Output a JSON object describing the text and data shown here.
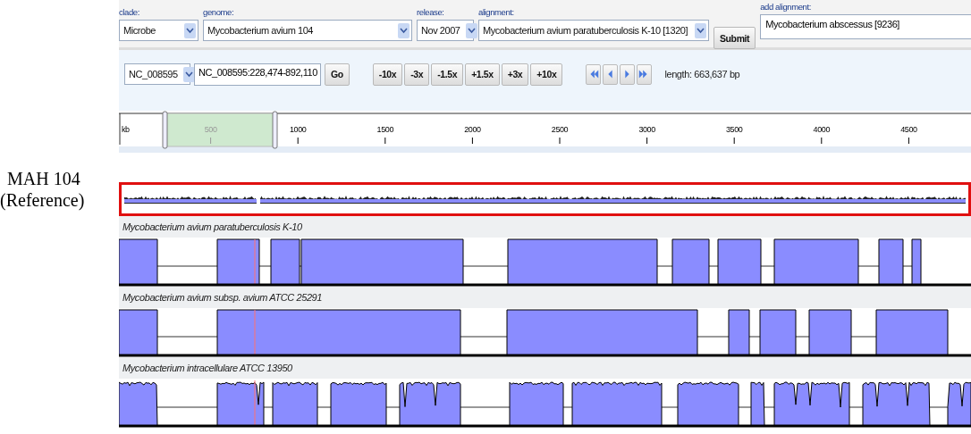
{
  "annotation": {
    "title": "MAH 104",
    "subtitle": "(Reference)"
  },
  "form": {
    "fields": [
      {
        "kind": "select",
        "label": "clade:",
        "value": "Microbe"
      },
      {
        "kind": "select",
        "label": "genome:",
        "value": "Mycobacterium avium 104"
      },
      {
        "kind": "select",
        "label": "release:",
        "value": "Nov 2007"
      },
      {
        "kind": "select",
        "label": "alignment:",
        "value": "Mycobacterium avium paratuberculosis K-10 [1320]"
      },
      {
        "kind": "button",
        "value": "Submit"
      },
      {
        "kind": "text",
        "label": "add alignment:",
        "value": "Mycobacterium abscessus [9236]"
      }
    ]
  },
  "navigation": {
    "chromosome": "NC_008595",
    "position": "NC_008595:228,474-892,110",
    "go": "Go",
    "zoom_buttons": [
      "-10x",
      "-3x",
      "-1.5x",
      "+1.5x",
      "+3x",
      "+10x"
    ],
    "length": "length: 663,637 bp"
  },
  "ruler": {
    "unit": "kb",
    "ticks": [
      "500",
      "1000",
      "1500",
      "2000",
      "2500",
      "3000",
      "3500",
      "4000",
      "4500"
    ]
  },
  "tracks": [
    {
      "name": "Mycobacterium avium paratuberculosis K-10"
    },
    {
      "name": "Mycobacterium avium subsp. avium ATCC 25291"
    },
    {
      "name": "Mycobacterium intracellulare ATCC 13950"
    }
  ]
}
